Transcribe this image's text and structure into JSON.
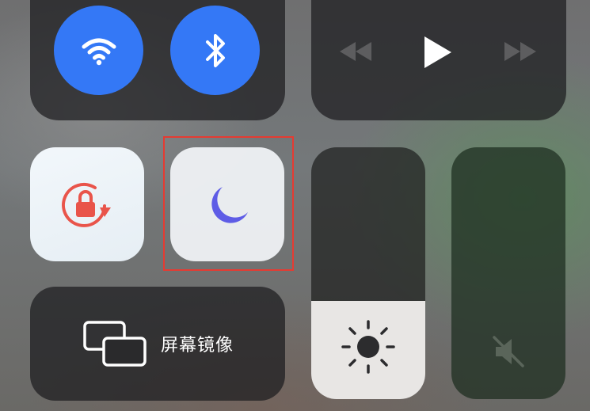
{
  "connectivity": {
    "wifi": {
      "icon": "wifi-icon",
      "state": "on",
      "color": "#3478f6"
    },
    "bluetooth": {
      "icon": "bluetooth-icon",
      "state": "on",
      "color": "#3478f6"
    }
  },
  "media": {
    "controls": [
      {
        "icon": "rewind-icon"
      },
      {
        "icon": "play-icon"
      },
      {
        "icon": "fast-forward-icon"
      }
    ]
  },
  "rotation_lock": {
    "icon": "rotation-lock-icon",
    "color": "#e9544a"
  },
  "do_not_disturb": {
    "icon": "moon-icon",
    "color": "#5e5ce6",
    "highlighted": true,
    "highlight_color": "#e53b32"
  },
  "brightness": {
    "icon": "sun-icon",
    "level": 0.39
  },
  "volume": {
    "icon": "speaker-muted-icon",
    "level": 0.0
  },
  "screen_mirroring": {
    "icon": "screen-mirroring-icon",
    "label": "屏幕镜像"
  }
}
